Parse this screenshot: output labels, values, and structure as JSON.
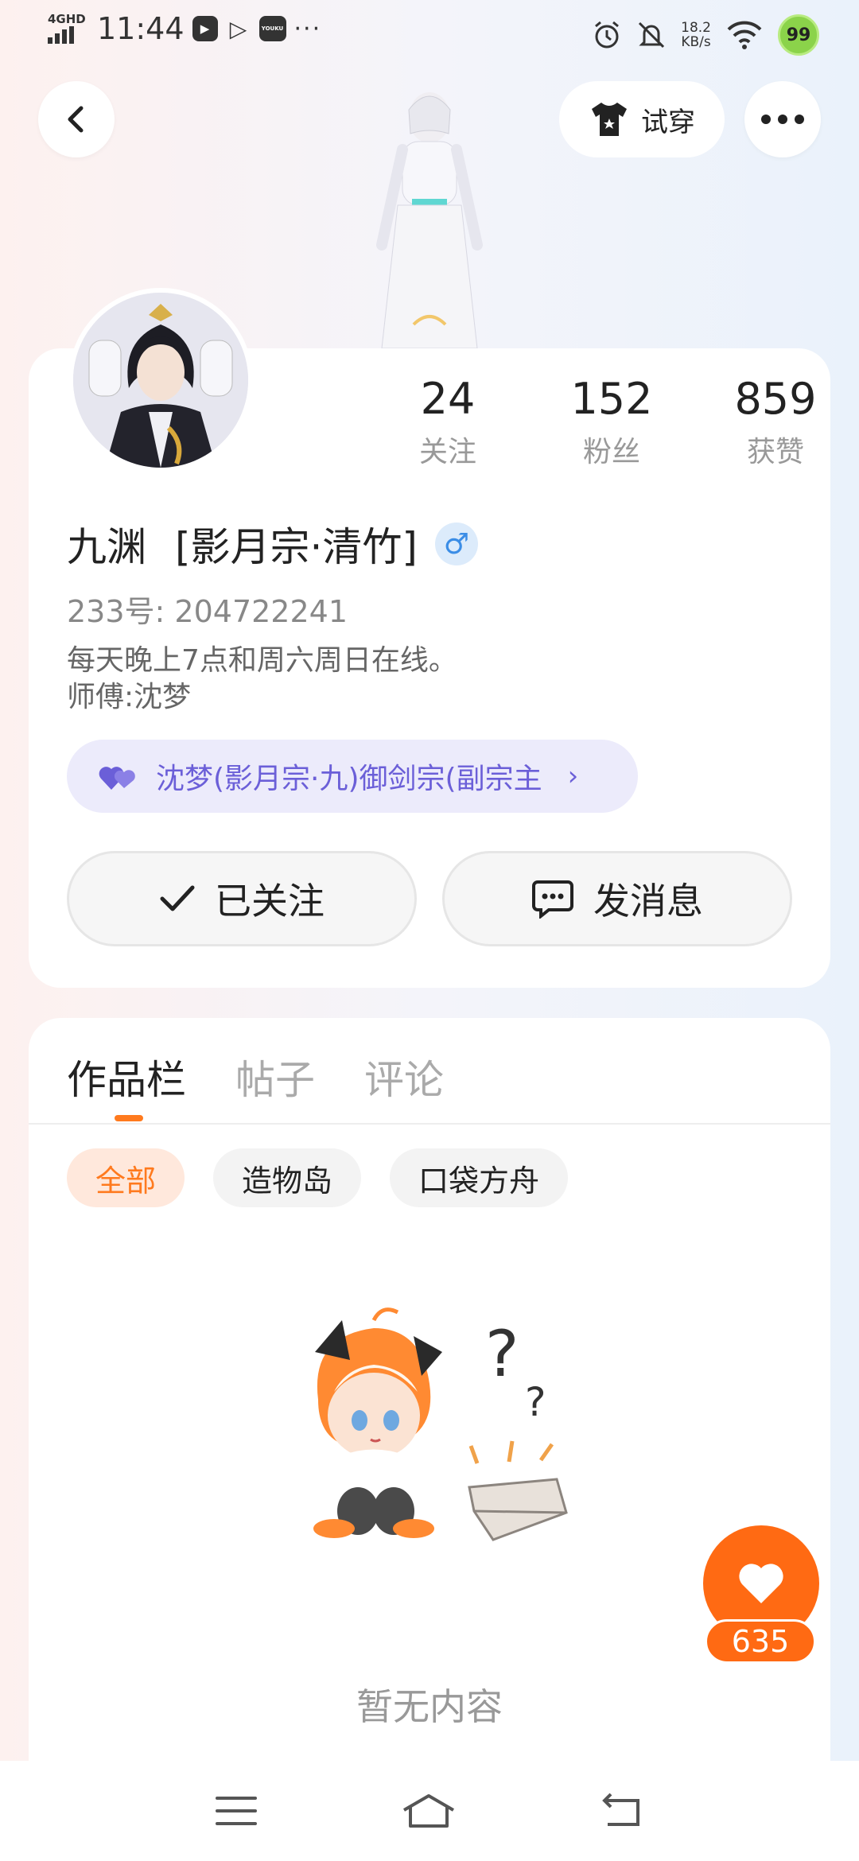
{
  "status_bar": {
    "network": "4GHD",
    "time": "11:44",
    "app_icons": [
      "play-icon",
      "video-icon",
      "youku-icon"
    ],
    "youku_label": "YOUKU",
    "more": "···",
    "speed_value": "18.2",
    "speed_unit": "KB/s",
    "battery": "99"
  },
  "header": {
    "tryon_label": "试穿"
  },
  "profile": {
    "stats": [
      {
        "value": "24",
        "label": "关注"
      },
      {
        "value": "152",
        "label": "粉丝"
      },
      {
        "value": "859",
        "label": "获赞"
      }
    ],
    "name": "九渊",
    "title": "[影月宗·清竹]",
    "gender": "♂",
    "uid": "233号:  204722241",
    "bio_line1": "每天晚上7点和周六周日在线。",
    "bio_line2": "师傅:沈梦",
    "guild_chip": "沈梦(影月宗·九)御剑宗(副宗主",
    "follow_label": "已关注",
    "message_label": "发消息"
  },
  "works": {
    "tabs": [
      "作品栏",
      "帖子",
      "评论"
    ],
    "active_tab": 0,
    "filters": [
      "全部",
      "造物岛",
      "口袋方舟"
    ],
    "active_filter": 0,
    "empty_text": "暂无内容"
  },
  "like_count": "635",
  "colors": {
    "accent": "#ff7a1e",
    "like": "#ff6a13",
    "guild": "#6b5fd8",
    "gender": "#3b8de6"
  }
}
